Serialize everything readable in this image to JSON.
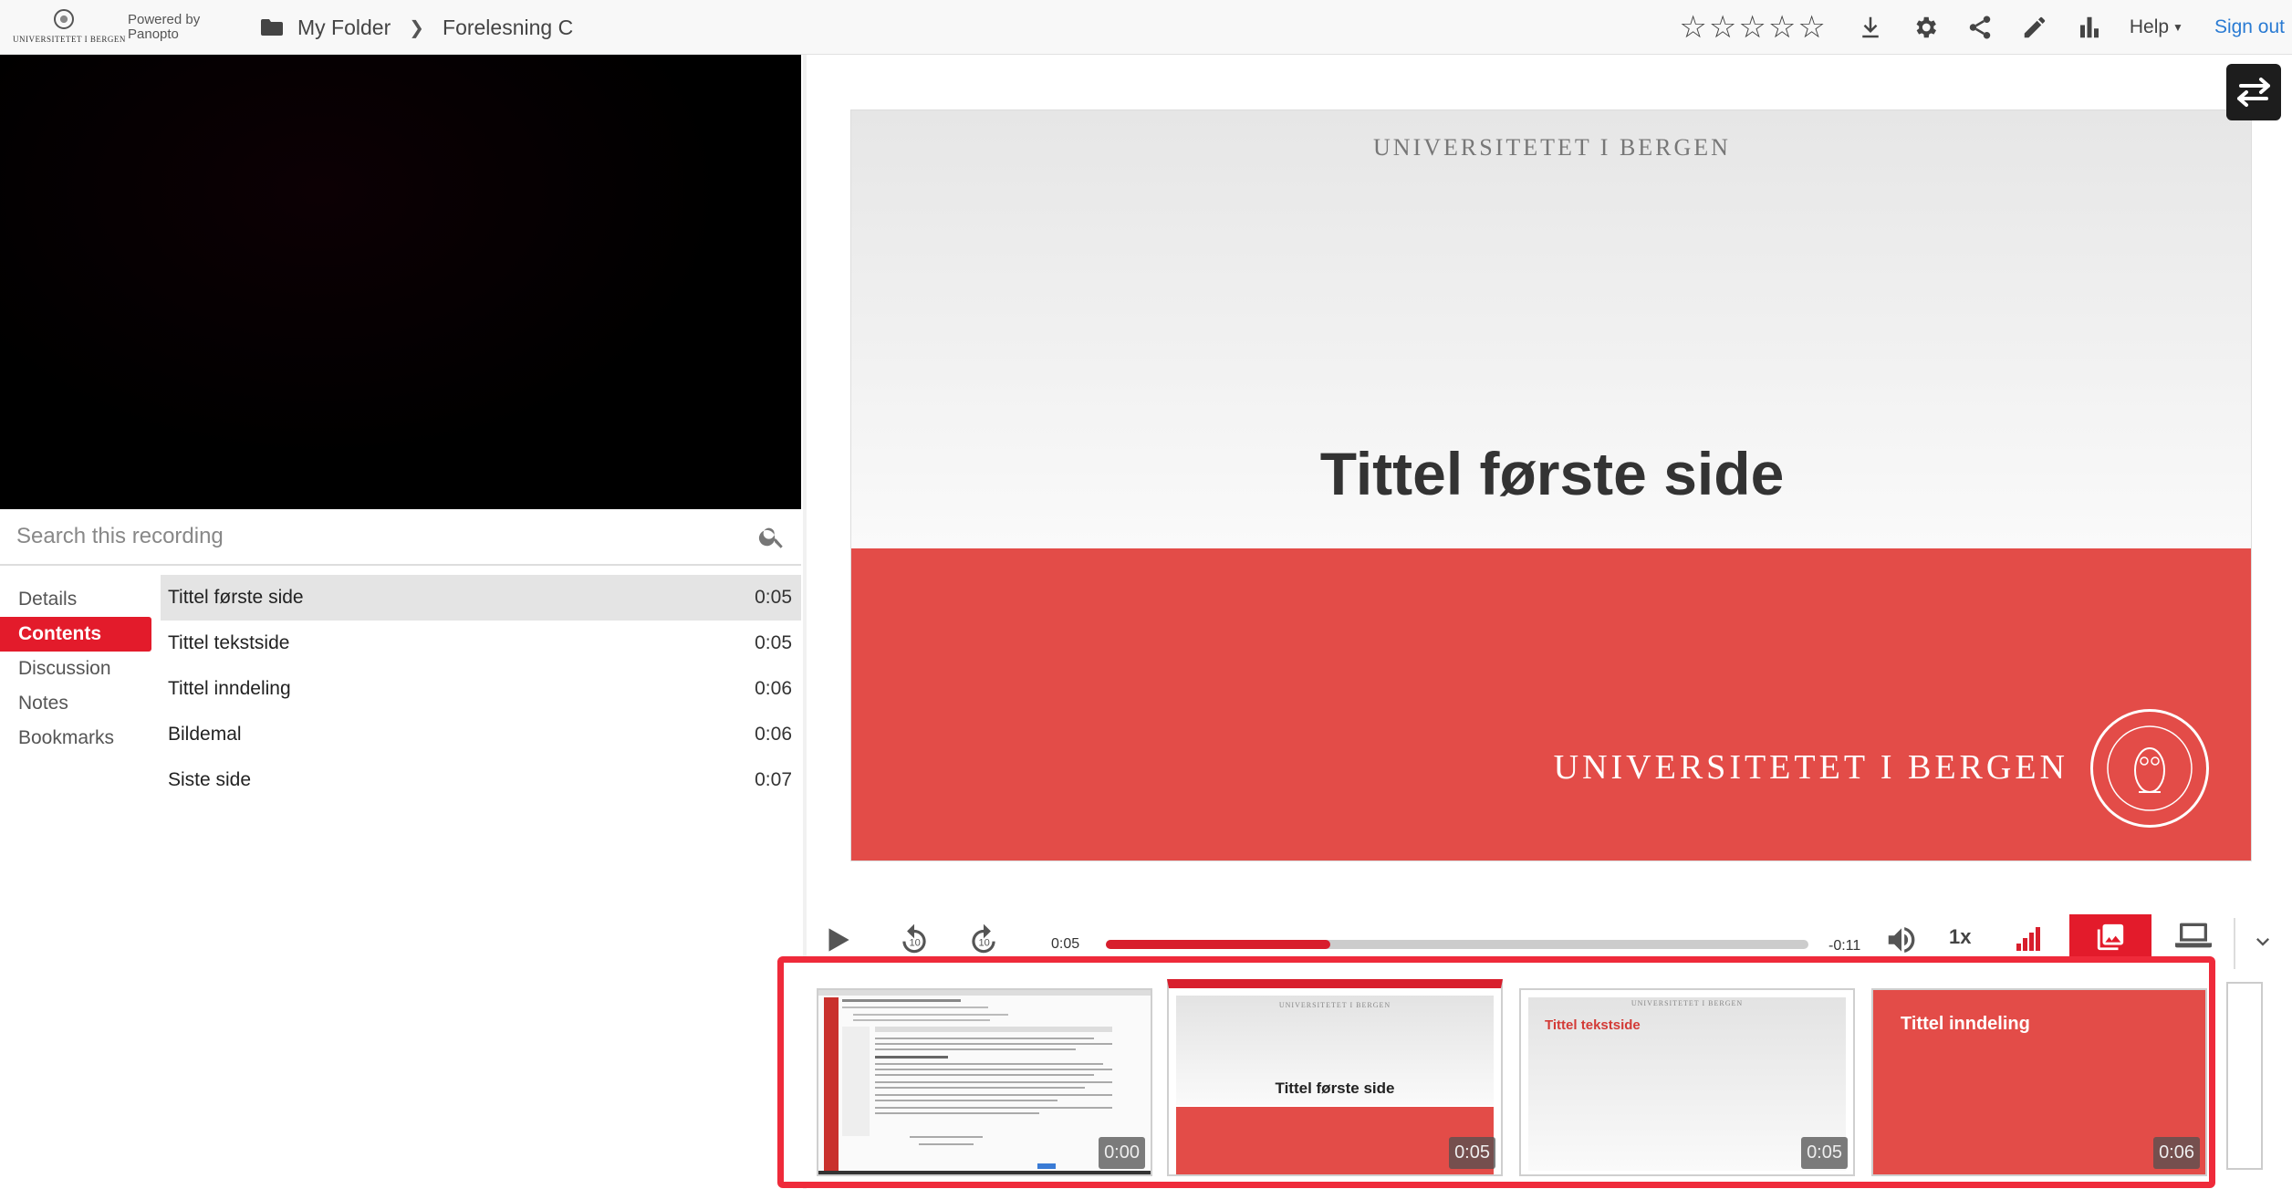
{
  "header": {
    "logo_text": "UNIVERSITETET I BERGEN",
    "powered_by": "Powered by",
    "powered_brand": "Panopto",
    "breadcrumb": {
      "folder": "My Folder",
      "current": "Forelesning C"
    },
    "rating_stars": 5,
    "help_label": "Help",
    "signout_label": "Sign out",
    "link_color": "#2a7bd3"
  },
  "search": {
    "placeholder": "Search this recording"
  },
  "tabs": [
    {
      "label": "Details",
      "active": false
    },
    {
      "label": "Contents",
      "active": true
    },
    {
      "label": "Discussion",
      "active": false
    },
    {
      "label": "Notes",
      "active": false
    },
    {
      "label": "Bookmarks",
      "active": false
    }
  ],
  "contents": [
    {
      "title": "Tittel første side",
      "time": "0:05",
      "selected": true
    },
    {
      "title": "Tittel tekstside",
      "time": "0:05",
      "selected": false
    },
    {
      "title": "Tittel inndeling",
      "time": "0:06",
      "selected": false
    },
    {
      "title": "Bildemal",
      "time": "0:06",
      "selected": false
    },
    {
      "title": "Siste side",
      "time": "0:07",
      "selected": false
    }
  ],
  "slide": {
    "top_text": "UNIVERSITETET I BERGEN",
    "title": "Tittel første side",
    "band_text": "UNIVERSITETET I BERGEN",
    "band_color": "#e34c48"
  },
  "player": {
    "current_time": "0:05",
    "remaining_time": "-0:11",
    "progress_fraction": 0.32,
    "speed": "1x",
    "accent": "#d81e2c"
  },
  "thumbnails": [
    {
      "kind": "screen",
      "time": "0:00"
    },
    {
      "kind": "title-slide",
      "title": "Tittel første side",
      "small_text": "UNIVERSITETET I BERGEN",
      "time": "0:05",
      "active": true
    },
    {
      "kind": "text-slide",
      "title": "Tittel tekstside",
      "small_text": "UNIVERSITETET I BERGEN",
      "time": "0:05"
    },
    {
      "kind": "section-slide",
      "title": "Tittel inndeling",
      "time": "0:06"
    }
  ]
}
